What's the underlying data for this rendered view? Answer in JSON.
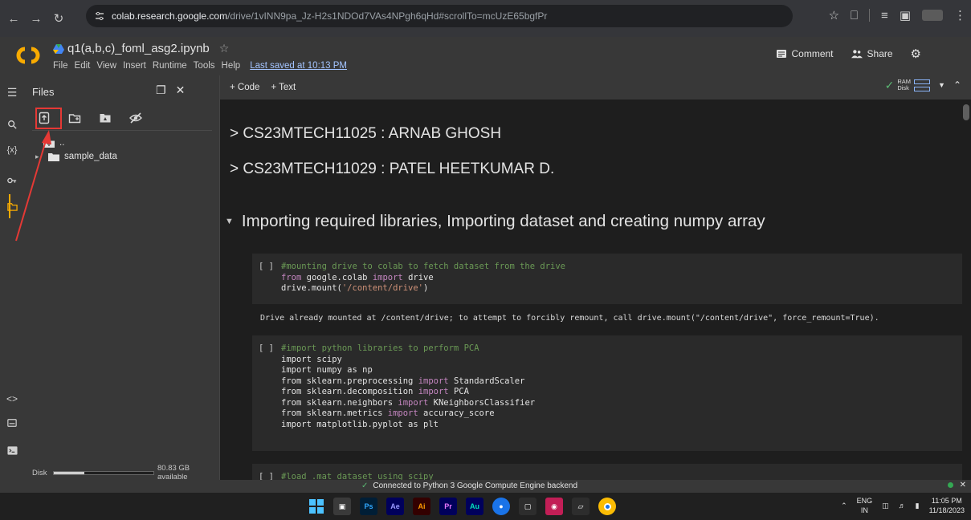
{
  "browser": {
    "url_host": "colab.research.google.com",
    "url_path": "/drive/1vINN9pa_Jz-H2s1NDOd7VAs4NPgh6qHd#scrollTo=mcUzE65bgfPr"
  },
  "header": {
    "title": "q1(a,b,c)_foml_asg2.ipynb",
    "menu": [
      "File",
      "Edit",
      "View",
      "Insert",
      "Runtime",
      "Tools",
      "Help"
    ],
    "last_saved": "Last saved at 10:13 PM",
    "comment_label": "Comment",
    "share_label": "Share"
  },
  "files": {
    "title": "Files",
    "parent": "..",
    "folder": "sample_data",
    "disk_label": "Disk",
    "disk_available": "80.83 GB available",
    "disk_used_fraction": 0.3
  },
  "toolbar": {
    "code_label": "+ Code",
    "text_label": "+ Text",
    "ram_label": "RAM",
    "disk_label": "Disk"
  },
  "notebook": {
    "author1": "> CS23MTECH11025 : ARNAB GHOSH",
    "author2": "> CS23MTECH11029 : PATEL HEETKUMAR D.",
    "section": "Importing required libraries, Importing dataset and creating numpy array",
    "cell1_run": "[ ]",
    "cell1": {
      "c1": "#mounting drive to colab to fetch dataset from the drive",
      "l2_kw1": "from",
      "l2_mod": " google.colab ",
      "l2_kw2": "import",
      "l2_name": " drive",
      "l3_pre": "drive.mount(",
      "l3_str": "'/content/drive'",
      "l3_post": ")"
    },
    "output1": "Drive already mounted at /content/drive; to attempt to forcibly remount, call drive.mount(\"/content/drive\", force_remount=True).",
    "cell2_run": "[ ]",
    "cell2": {
      "c1": "#import python libraries to perform PCA",
      "l2": "import scipy",
      "l3": "import numpy as np",
      "l4a": "from sklearn.preprocessing ",
      "l4b": "import",
      "l4c": " StandardScaler",
      "l5a": "from sklearn.decomposition ",
      "l5b": "import",
      "l5c": " PCA",
      "l6a": "from sklearn.neighbors ",
      "l6b": "import",
      "l6c": " KNeighborsClassifier",
      "l7a": "from sklearn.metrics ",
      "l7b": "import",
      "l7c": " accuracy_score",
      "l8": "import matplotlib.pyplot as plt"
    },
    "cell3_run": "[ ]",
    "cell3_c1": "#load .mat dataset using scipy"
  },
  "status": {
    "message": "Connected to Python 3 Google Compute Engine backend"
  },
  "taskbar": {
    "lang_top": "ENG",
    "lang_bottom": "IN",
    "time": "11:05 PM",
    "date": "11/18/2023",
    "apps": [
      "Ps",
      "Ae",
      "Ai",
      "Pr",
      "Au"
    ]
  },
  "colors": {
    "accent_orange": "#f9ab00",
    "highlight_red": "#e53935",
    "status_green": "#34a853"
  }
}
